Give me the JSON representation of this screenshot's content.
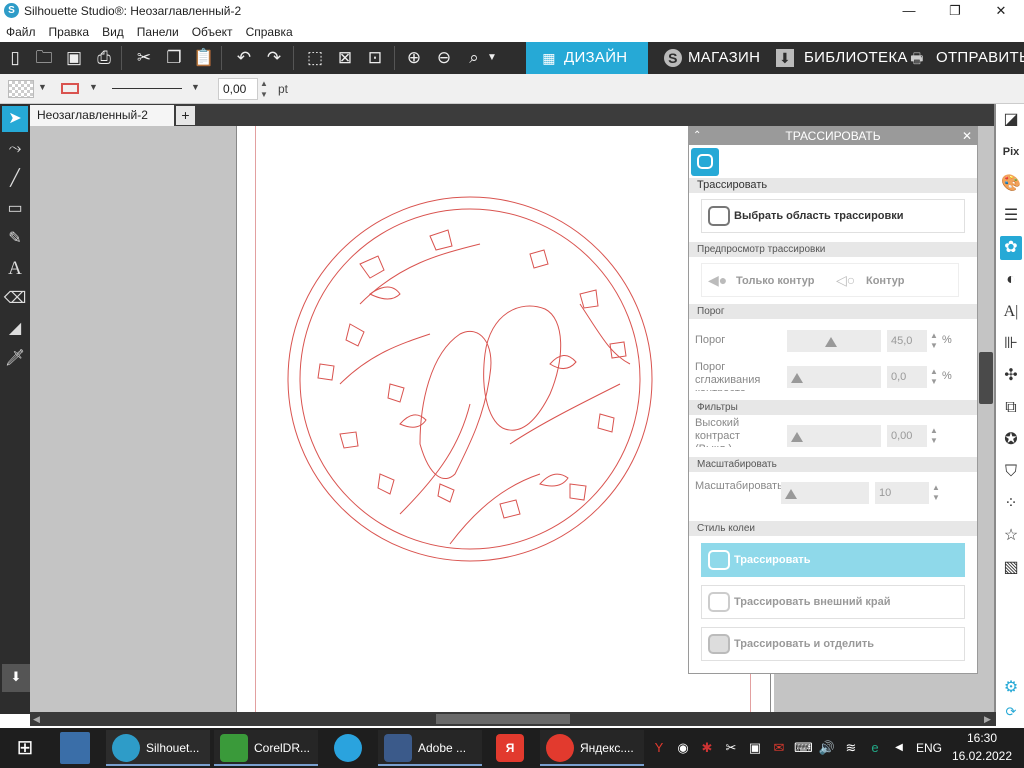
{
  "window": {
    "title": "Silhouette Studio®: Неозаглавленный-2",
    "minimize": "—",
    "maximize": "❐",
    "close": "✕"
  },
  "menu": [
    "Файл",
    "Правка",
    "Вид",
    "Панели",
    "Объект",
    "Справка"
  ],
  "nav_tabs": [
    {
      "label": "ДИЗАЙН",
      "icon": "grid-icon",
      "active": true
    },
    {
      "label": "МАГАЗИН",
      "icon": "silhouette-s-icon",
      "active": false
    },
    {
      "label": "БИБЛИОТЕКА",
      "icon": "library-download-icon",
      "active": false
    },
    {
      "label": "ОТПРАВИТЬ",
      "icon": "cutter-icon",
      "active": false
    }
  ],
  "options_bar": {
    "line_width_value": "0,00",
    "line_width_unit": "pt"
  },
  "document_tab": {
    "name": "Неозаглавленный-2",
    "add": "+"
  },
  "trace_panel": {
    "title": "ТРАССИРОВАТЬ",
    "section_trace": "Трассировать",
    "select_area_button": "Выбрать область трассировки",
    "section_preview": "Предпросмотр трассировки",
    "preview_outline_only": "Только контур",
    "preview_outline": "Контур",
    "section_threshold": "Порог",
    "threshold_label": "Порог",
    "threshold_value": "45,0",
    "threshold_unit": "%",
    "smoothing_label": "Порог сглаживания контраста",
    "smoothing_value": "0,0",
    "smoothing_unit": "%",
    "section_filters": "Фильтры",
    "highpass_label": "Высокий контраст (Выкл.)",
    "highpass_value": "0,00",
    "section_scale": "Масштабировать",
    "scale_label": "Масштабировать",
    "scale_value": "10",
    "section_style": "Стиль колеи",
    "btn_trace": "Трассировать",
    "btn_trace_outer": "Трассировать внешний край",
    "btn_trace_detach": "Трассировать и отделить"
  },
  "taskbar": {
    "apps": [
      {
        "label": "Silhouet...",
        "icon": "silhouette-app-icon",
        "color": "#2e9cc8"
      },
      {
        "label": "CorelDR...",
        "icon": "coreldraw-icon",
        "color": "#3a9a3a"
      },
      {
        "label": "",
        "icon": "telegram-icon",
        "color": "#2aa3de"
      },
      {
        "label": "Adobe ...",
        "icon": "adobe-icon",
        "color": "#3b5a8a"
      },
      {
        "label": "",
        "icon": "yandex-icon",
        "color": "#e23a2e"
      },
      {
        "label": "Яндекс....",
        "icon": "yandex-browser-icon",
        "color": "#e23a2e"
      }
    ],
    "language": "ENG",
    "time": "16:30",
    "date": "16.02.2022"
  },
  "colors": {
    "accent_active_tab": "#26a9d6",
    "tab_bar_bg": "#2d2d2d",
    "trace_button": "#8fd9ea",
    "cut_line": "#d9534f"
  }
}
